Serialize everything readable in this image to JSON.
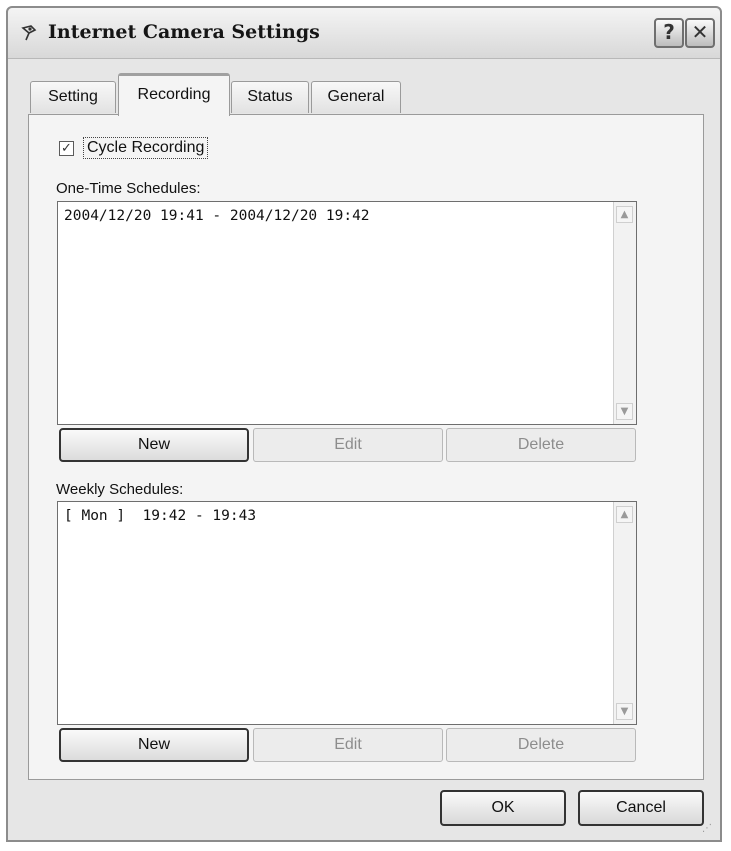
{
  "window": {
    "title": "Internet Camera Settings",
    "help_label": "?",
    "close_label": "✕"
  },
  "tabs": [
    {
      "label": "Setting"
    },
    {
      "label": "Recording",
      "active": true
    },
    {
      "label": "Status"
    },
    {
      "label": "General"
    }
  ],
  "cycle_recording": {
    "label": "Cycle Recording",
    "checked": true,
    "check_glyph": "✓"
  },
  "one_time": {
    "label": "One-Time Schedules:",
    "items": [
      "2004/12/20 19:41 - 2004/12/20 19:42"
    ],
    "new_label": "New",
    "edit_label": "Edit",
    "delete_label": "Delete"
  },
  "weekly": {
    "label": "Weekly Schedules:",
    "items": [
      "[ Mon ]  19:42 - 19:43"
    ],
    "new_label": "New",
    "edit_label": "Edit",
    "delete_label": "Delete"
  },
  "footer": {
    "ok_label": "OK",
    "cancel_label": "Cancel"
  },
  "icons": {
    "scroll_up": "scroll-up-arrow-icon",
    "scroll_down": "scroll-down-arrow-icon",
    "window": "camera-app-icon",
    "grip": "resize-grip-icon"
  }
}
